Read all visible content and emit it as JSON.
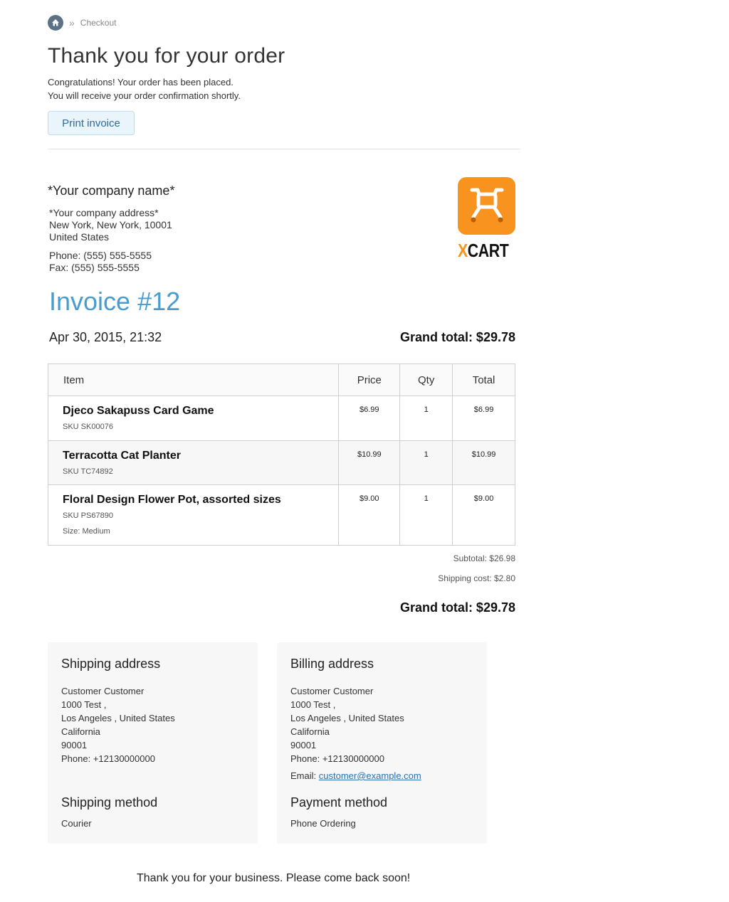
{
  "breadcrumb": {
    "separator": "»",
    "current": "Checkout"
  },
  "header": {
    "title": "Thank you for your order",
    "message_line1": "Congratulations! Your order has been placed.",
    "message_line2": "You will receive your order confirmation shortly.",
    "print_label": "Print invoice"
  },
  "company": {
    "name": "*Your company name*",
    "address_line1": "*Your company address*",
    "address_line2": "New York, New York, 10001",
    "address_line3": "United States",
    "phone": "Phone: (555) 555-5555",
    "fax": "Fax: (555) 555-5555",
    "logo_text_x": "X",
    "logo_text_rest": "CART",
    "colors": {
      "logo_orange": "#f7931e"
    }
  },
  "invoice": {
    "title": "Invoice #12",
    "date": "Apr 30, 2015, 21:32",
    "grand_total_label": "Grand total: $29.78"
  },
  "table": {
    "headers": {
      "item": "Item",
      "price": "Price",
      "qty": "Qty",
      "total": "Total"
    },
    "rows": [
      {
        "name": "Djeco Sakapuss Card Game",
        "sku": "SKU SK00076",
        "attr": "",
        "price": "$6.99",
        "qty": "1",
        "total": "$6.99"
      },
      {
        "name": "Terracotta Cat Planter",
        "sku": "SKU TC74892",
        "attr": "",
        "price": "$10.99",
        "qty": "1",
        "total": "$10.99"
      },
      {
        "name": "Floral Design Flower Pot, assorted sizes",
        "sku": "SKU PS67890",
        "attr": "Size: Medium",
        "price": "$9.00",
        "qty": "1",
        "total": "$9.00"
      }
    ]
  },
  "totals": {
    "subtotal": "Subtotal: $26.98",
    "shipping": "Shipping cost: $2.80",
    "grand_total": "Grand total: $29.78"
  },
  "shipping_address": {
    "title": "Shipping address",
    "name": "Customer Customer",
    "street": "1000 Test ,",
    "city": "Los Angeles , United States",
    "state": "California",
    "zip": "90001",
    "phone": "Phone: +12130000000"
  },
  "billing_address": {
    "title": "Billing address",
    "name": "Customer Customer",
    "street": "1000 Test ,",
    "city": "Los Angeles , United States",
    "state": "California",
    "zip": "90001",
    "phone": "Phone: +12130000000",
    "email_label": "Email:",
    "email": "customer@example.com"
  },
  "shipping_method": {
    "title": "Shipping method",
    "value": "Courier"
  },
  "payment_method": {
    "title": "Payment method",
    "value": "Phone Ordering"
  },
  "footer": {
    "thanks": "Thank you for your business. Please come back soon!"
  }
}
